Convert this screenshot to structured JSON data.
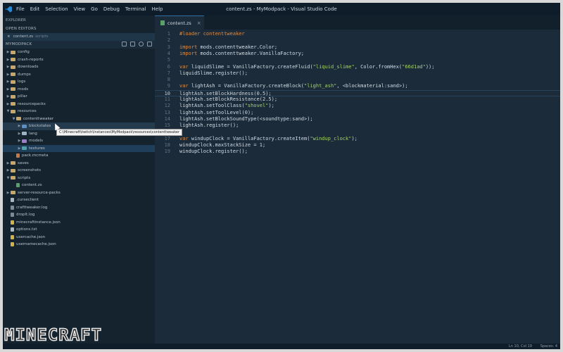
{
  "window": {
    "title": "content.zs - MyModpack - Visual Studio Code"
  },
  "menu": [
    "File",
    "Edit",
    "Selection",
    "View",
    "Go",
    "Debug",
    "Terminal",
    "Help"
  ],
  "sidebar": {
    "explorer_label": "EXPLORER",
    "open_editors_label": "OPEN EDITORS",
    "open_file": {
      "name": "content.zs",
      "path": "scripts"
    },
    "project_label": "MYMODPACK",
    "tree": [
      {
        "label": "config",
        "type": "folder",
        "depth": 0,
        "open": false
      },
      {
        "label": "crash-reports",
        "type": "folder",
        "depth": 0,
        "open": false
      },
      {
        "label": "downloads",
        "type": "folder",
        "depth": 0,
        "open": false
      },
      {
        "label": "dumps",
        "type": "folder",
        "depth": 0,
        "open": false
      },
      {
        "label": "logs",
        "type": "folder",
        "depth": 0,
        "open": false
      },
      {
        "label": "mods",
        "type": "folder",
        "depth": 0,
        "open": false
      },
      {
        "label": "pillar",
        "type": "folder",
        "depth": 0,
        "open": false
      },
      {
        "label": "resourcepacks",
        "type": "folder",
        "depth": 0,
        "open": false
      },
      {
        "label": "resources",
        "type": "folder",
        "depth": 0,
        "open": true
      },
      {
        "label": "contenttweaker",
        "type": "folder",
        "depth": 1,
        "open": true
      },
      {
        "label": "blockstates",
        "type": "folder",
        "depth": 2,
        "open": false,
        "hover": true
      },
      {
        "label": "lang",
        "type": "folder",
        "depth": 2,
        "open": false
      },
      {
        "label": "models",
        "type": "folder",
        "depth": 2,
        "open": false
      },
      {
        "label": "textures",
        "type": "folder",
        "depth": 2,
        "open": false,
        "selected": true
      },
      {
        "label": "pack.mcmeta",
        "type": "file",
        "ext": "meta",
        "depth": 1
      },
      {
        "label": "saves",
        "type": "folder",
        "depth": 0,
        "open": false
      },
      {
        "label": "screenshots",
        "type": "folder",
        "depth": 0,
        "open": false
      },
      {
        "label": "scripts",
        "type": "folder",
        "depth": 0,
        "open": true
      },
      {
        "label": "content.zs",
        "type": "file",
        "ext": "zs",
        "depth": 1
      },
      {
        "label": "server-resource-packs",
        "type": "folder",
        "depth": 0,
        "open": false
      },
      {
        "label": ".curseclient",
        "type": "file",
        "ext": "txt",
        "depth": 0
      },
      {
        "label": "crafttweaker.log",
        "type": "file",
        "ext": "log",
        "depth": 0
      },
      {
        "label": "droplt.log",
        "type": "file",
        "ext": "log",
        "depth": 0
      },
      {
        "label": "minecraftinstance.json",
        "type": "file",
        "ext": "json",
        "depth": 0
      },
      {
        "label": "options.txt",
        "type": "file",
        "ext": "txt",
        "depth": 0
      },
      {
        "label": "usercache.json",
        "type": "file",
        "ext": "json",
        "depth": 0
      },
      {
        "label": "usernamecache.json",
        "type": "file",
        "ext": "json",
        "depth": 0
      }
    ],
    "tooltip": "C:\\Minecraft\\twitch\\Instances\\MyModpack\\resources\\contenttweaker"
  },
  "tab": {
    "name": "content.zs"
  },
  "editor": {
    "current_line": 10,
    "lines": [
      {
        "n": "1",
        "parts": [
          [
            "cm",
            "#loader contenttweaker"
          ]
        ]
      },
      {
        "n": "2",
        "parts": []
      },
      {
        "n": "3",
        "parts": [
          [
            "kw",
            "import"
          ],
          [
            "ty",
            " mods.contenttweaker.Color;"
          ]
        ]
      },
      {
        "n": "4",
        "parts": [
          [
            "kw",
            "import"
          ],
          [
            "ty",
            " mods.contenttweaker.VanillaFactory;"
          ]
        ]
      },
      {
        "n": "5",
        "parts": []
      },
      {
        "n": "6",
        "parts": [
          [
            "kw",
            "var"
          ],
          [
            "ty",
            " liquidSlime = VanillaFactory.createFluid("
          ],
          [
            "str",
            "\"liquid_slime\""
          ],
          [
            "ty",
            ", Color.fromHex("
          ],
          [
            "str",
            "\"66d1ad\""
          ],
          [
            "ty",
            "));"
          ]
        ]
      },
      {
        "n": "7",
        "parts": [
          [
            "ty",
            "liquidSlime.register();"
          ]
        ]
      },
      {
        "n": "8",
        "parts": []
      },
      {
        "n": "9",
        "parts": [
          [
            "kw",
            "var"
          ],
          [
            "ty",
            " lightAsh = VanillaFactory.createBlock("
          ],
          [
            "str",
            "\"light_ash\""
          ],
          [
            "ty",
            ", <blockmaterial:sand>);"
          ]
        ]
      },
      {
        "n": "10",
        "parts": [
          [
            "ty",
            "lightAsh.setBlockHardness(0.5);"
          ]
        ]
      },
      {
        "n": "11",
        "parts": [
          [
            "ty",
            "lightAsh.setBlockResistance(2.5);"
          ]
        ]
      },
      {
        "n": "12",
        "parts": [
          [
            "ty",
            "lightAsh.setToolClass("
          ],
          [
            "str",
            "\"shovel\""
          ],
          [
            "ty",
            ");"
          ]
        ]
      },
      {
        "n": "13",
        "parts": [
          [
            "ty",
            "lightAsh.setToolLevel(0);"
          ]
        ]
      },
      {
        "n": "14",
        "parts": [
          [
            "ty",
            "lightAsh.setBlockSoundType(<soundtype:sand>);"
          ]
        ]
      },
      {
        "n": "15",
        "parts": [
          [
            "ty",
            "lightAsh.register();"
          ]
        ]
      },
      {
        "n": "16",
        "parts": []
      },
      {
        "n": "17",
        "parts": [
          [
            "kw",
            "var"
          ],
          [
            "ty",
            " windupClock = VanillaFactory.createItem("
          ],
          [
            "str",
            "\"windup_clock\""
          ],
          [
            "ty",
            ");"
          ]
        ]
      },
      {
        "n": "18",
        "parts": [
          [
            "ty",
            "windupClock.maxStackSize = 1;"
          ]
        ]
      },
      {
        "n": "19",
        "parts": [
          [
            "ty",
            "windupClock.register();"
          ]
        ]
      }
    ]
  },
  "status": {
    "position": "Ln 10, Col 19",
    "indent": "Spaces: 4"
  },
  "logo": "MINECRAFT",
  "colors": {
    "background": "#1b2b3a",
    "sidebar": "#15232f",
    "keyword": "#e28c41",
    "string": "#a5d46a"
  }
}
